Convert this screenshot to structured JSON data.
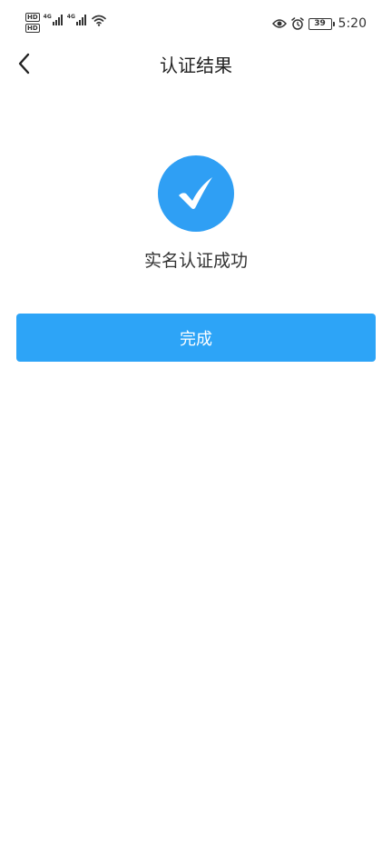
{
  "status_bar": {
    "hd_label_1": "HD",
    "hd_label_2": "HD",
    "network_1": "4G",
    "network_2": "4G",
    "battery_level": "39",
    "time": "5:20"
  },
  "nav": {
    "title": "认证结果"
  },
  "result": {
    "message": "实名认证成功"
  },
  "actions": {
    "done_label": "完成"
  },
  "colors": {
    "accent": "#2f9ff4",
    "button": "#2da4f7"
  },
  "icons": {
    "back": "chevron-left-icon",
    "success": "checkmark-circle-icon"
  }
}
